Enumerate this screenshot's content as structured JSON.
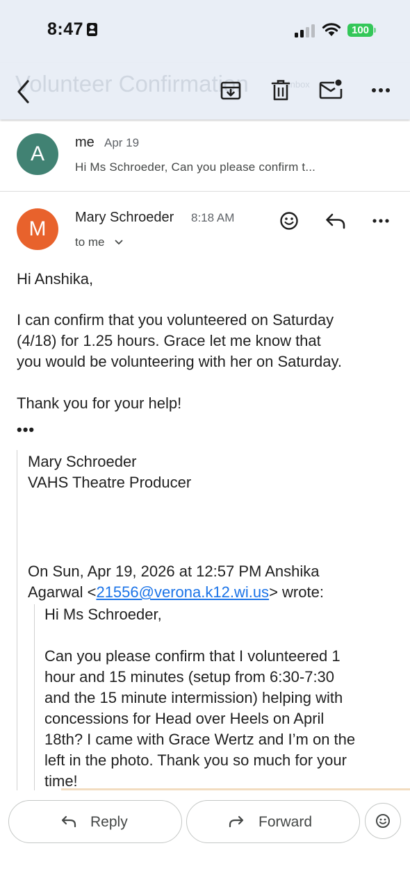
{
  "status_bar": {
    "time": "8:47",
    "battery": "100"
  },
  "app_bar": {
    "title": "Volunteer Confirmation",
    "label": "Inbox"
  },
  "collapsed_message": {
    "avatar_letter": "A",
    "avatar_color": "#418273",
    "sender": "me",
    "date": "Apr 19",
    "snippet": "Hi Ms Schroeder, Can you please confirm t..."
  },
  "message": {
    "avatar_letter": "M",
    "avatar_color": "#e8622c",
    "sender": "Mary Schroeder",
    "time": "8:18 AM",
    "recipient": "to me",
    "greeting": "Hi Anshika,",
    "paragraph_lines": [
      "I can confirm that you volunteered on Saturday",
      "(4/18) for 1.25 hours. Grace let me know that",
      "you would be volunteering with her on Saturday."
    ],
    "closing": "Thank you for your help!",
    "collapsed_dots": "•••",
    "signature_name": "Mary Schroeder",
    "signature_title": "VAHS Theatre Producer",
    "quote_header_line1": "On Sun, Apr 19, 2026 at 12:57 PM Anshika",
    "quote_header_prefix": "Agarwal <",
    "quote_email": "21556@verona.k12.wi.us",
    "quote_header_suffix": "> wrote:",
    "quoted_greeting": "Hi Ms Schroeder,",
    "quoted_lines": [
      "Can you please confirm that I volunteered 1",
      "hour and 15 minutes (setup from 6:30-7:30",
      "and the 15 minute intermission) helping with",
      "concessions for Head over Heels on April",
      "18th? I came with Grace Wertz and I’m on the",
      "left in the photo. Thank you so much for your",
      "time!"
    ]
  },
  "actions": {
    "reply_label": "Reply",
    "forward_label": "Forward"
  },
  "colors": {
    "link": "#1a73e8",
    "appbar_bg": "#e9eef6",
    "battery": "#34c759"
  }
}
